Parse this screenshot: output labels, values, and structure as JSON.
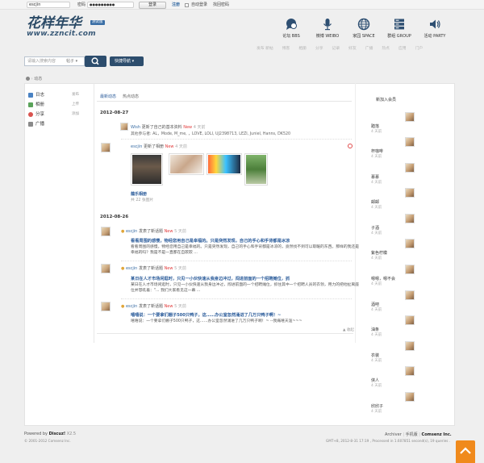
{
  "login": {
    "username_value": "escjin",
    "password_label": "密码",
    "password_value": "●●●●●●●●●",
    "login_button": "登录",
    "register_link": "注册",
    "auto_login_label": "自动登录",
    "find_password_link": "找回密码"
  },
  "site": {
    "logo_text": "花样年华",
    "logo_badge": "测试版",
    "logo_domain": "www.zzncit.com"
  },
  "nav": [
    {
      "label": "论坛 BBS",
      "icon": "chat-bubble-icon"
    },
    {
      "label": "微博 WEIBO",
      "icon": "microphone-icon"
    },
    {
      "label": "家园 SPACE",
      "icon": "globe-icon"
    },
    {
      "label": "群组 GROUP",
      "icon": "server-stack-icon"
    },
    {
      "label": "活动 PARTY",
      "icon": "speaker-icon"
    }
  ],
  "subnav": [
    "发布 新帖",
    "博客",
    "相册",
    "分享",
    "记录",
    "好友",
    "广播",
    "热点",
    "应用",
    "门户"
  ],
  "search": {
    "placeholder": "请输入搜索内容",
    "scope": "帖子",
    "quick_nav": "快捷导航"
  },
  "breadcrumb": "动态",
  "sidebar": [
    {
      "label": "日志",
      "action": "发布",
      "color": "#4a82c3"
    },
    {
      "label": "相册",
      "action": "上传",
      "color": "#5aa35a"
    },
    {
      "label": "分享",
      "action": "添加",
      "color": "#d9534f"
    },
    {
      "label": "广播",
      "action": "",
      "color": "#8a8a8a"
    }
  ],
  "tabs": [
    "最新动态",
    "热点动态"
  ],
  "feed": {
    "date1": "2012-08-27",
    "item1": {
      "user": "Wish",
      "action": "更新了自己的基本资料",
      "new": "New",
      "time": "4 天前",
      "detail": "其他参与者: AL，Mode, M_me, ，LOVE, LOLI, UJ2398713, LEZI, Juniel, Hanns, DK520"
    },
    "item2": {
      "user": "escjin",
      "action": "更新了相册",
      "new": "New",
      "time": "4 天前",
      "album": "蕴乐相册",
      "count": "共 22 张图片"
    },
    "date2": "2012-08-26",
    "posts": [
      {
        "user": "escjin",
        "action": "发表了新话题",
        "new": "New",
        "time": "5 天前",
        "title": "看看周围的感慢，物经您用自己是幸福的。只是突然发现，自己的手心和手背都是冰凉",
        "body": "看看周围的感慢，物经您用自己是幸福的。只是突然发现，自己的手心和手背都是冰凉的，竟然找不到可以取暖的东西。那样的我还是幸福的吗？我是不是一直都在自欺欺 ..."
      },
      {
        "user": "escjin",
        "action": "发表了新话题",
        "new": "New",
        "time": "5 天前",
        "title": "某日在人才市场闲逛时，只见一小伙快速从我身边冲过，闯进前面的一个招聘摊位，抓",
        "body": "某日在人才市场闲逛时，只见一小伙快速从我身边冲过，闯进前面的一个招聘摊位，抓住其中一个招聘人员的衣领，用力的把他扯离座位并怒吼着：\"... 我们大家看见这一幕 ..."
      },
      {
        "user": "escjin",
        "action": "发表了新话题",
        "new": "New",
        "time": "5 天前",
        "title": "嘻嘻说：一个要拿们棚子500只鸭子，这……办公室忽然涌进了几万只鸭子啊！~",
        "body": "嘻嘻说：一个要拿们棚子500只鸭子，这……办公室忽然涌进了几万只鸭子啊！~ --我痛嘻天涯~~~"
      }
    ],
    "collapse": "▲ 收起"
  },
  "members": {
    "title": "新加入会员",
    "list": [
      {
        "name": "踏落",
        "time": "4 天前"
      },
      {
        "name": "杯咖啡",
        "time": "4 天前"
      },
      {
        "name": "慕慕",
        "time": "4 天前"
      },
      {
        "name": "邮邮",
        "time": "4 天前"
      },
      {
        "name": "子酒",
        "time": "4 天前"
      },
      {
        "name": "紫色柠檬",
        "time": "4 天前"
      },
      {
        "name": "嗯嗯，嗯不会",
        "time": "4 天前"
      },
      {
        "name": "酒吧",
        "time": "4 天前"
      },
      {
        "name": "油条",
        "time": "4 天前"
      },
      {
        "name": "衣装",
        "time": "4 天前"
      },
      {
        "name": "侠人",
        "time": "4 天前"
      },
      {
        "name": "欣欣子",
        "time": "4 天前"
      }
    ]
  },
  "footer": {
    "powered": "Powered by",
    "discuz": "Discuz!",
    "version": "X2.5",
    "copyright": "© 2001-2012 Comsenz Inc.",
    "archiver": "Archiver",
    "mobile": "手机版",
    "comsenz": "Comsenz Inc.",
    "stats": "GMT+8, 2012-8-31 17:19 , Processed in 1.607851 second(s), 19 queries ."
  }
}
